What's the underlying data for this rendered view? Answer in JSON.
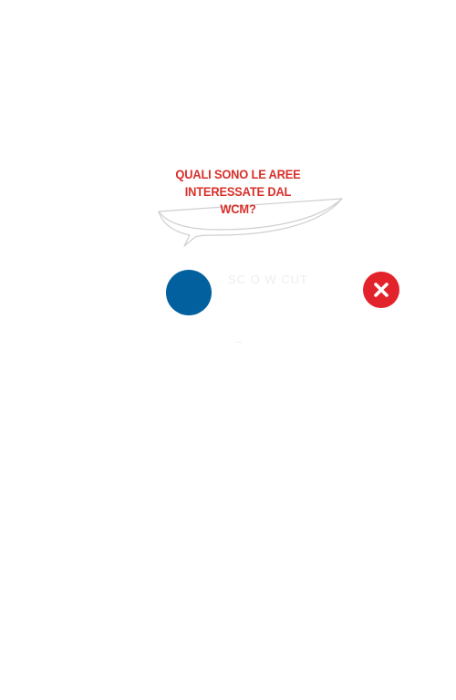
{
  "question": {
    "text": "QUALI SONO LE AREE INTERESSATE DAL WCM?"
  },
  "answer": {
    "label": "SC O W CUT",
    "dot_color": "#02609f"
  },
  "close": {
    "icon": "close-x-icon",
    "color": "#e3232b"
  },
  "hint": {
    "text": "–"
  },
  "colors": {
    "question_text": "#d8302b",
    "bubble_outline": "#cfcfcf",
    "background": "#ffffff"
  }
}
